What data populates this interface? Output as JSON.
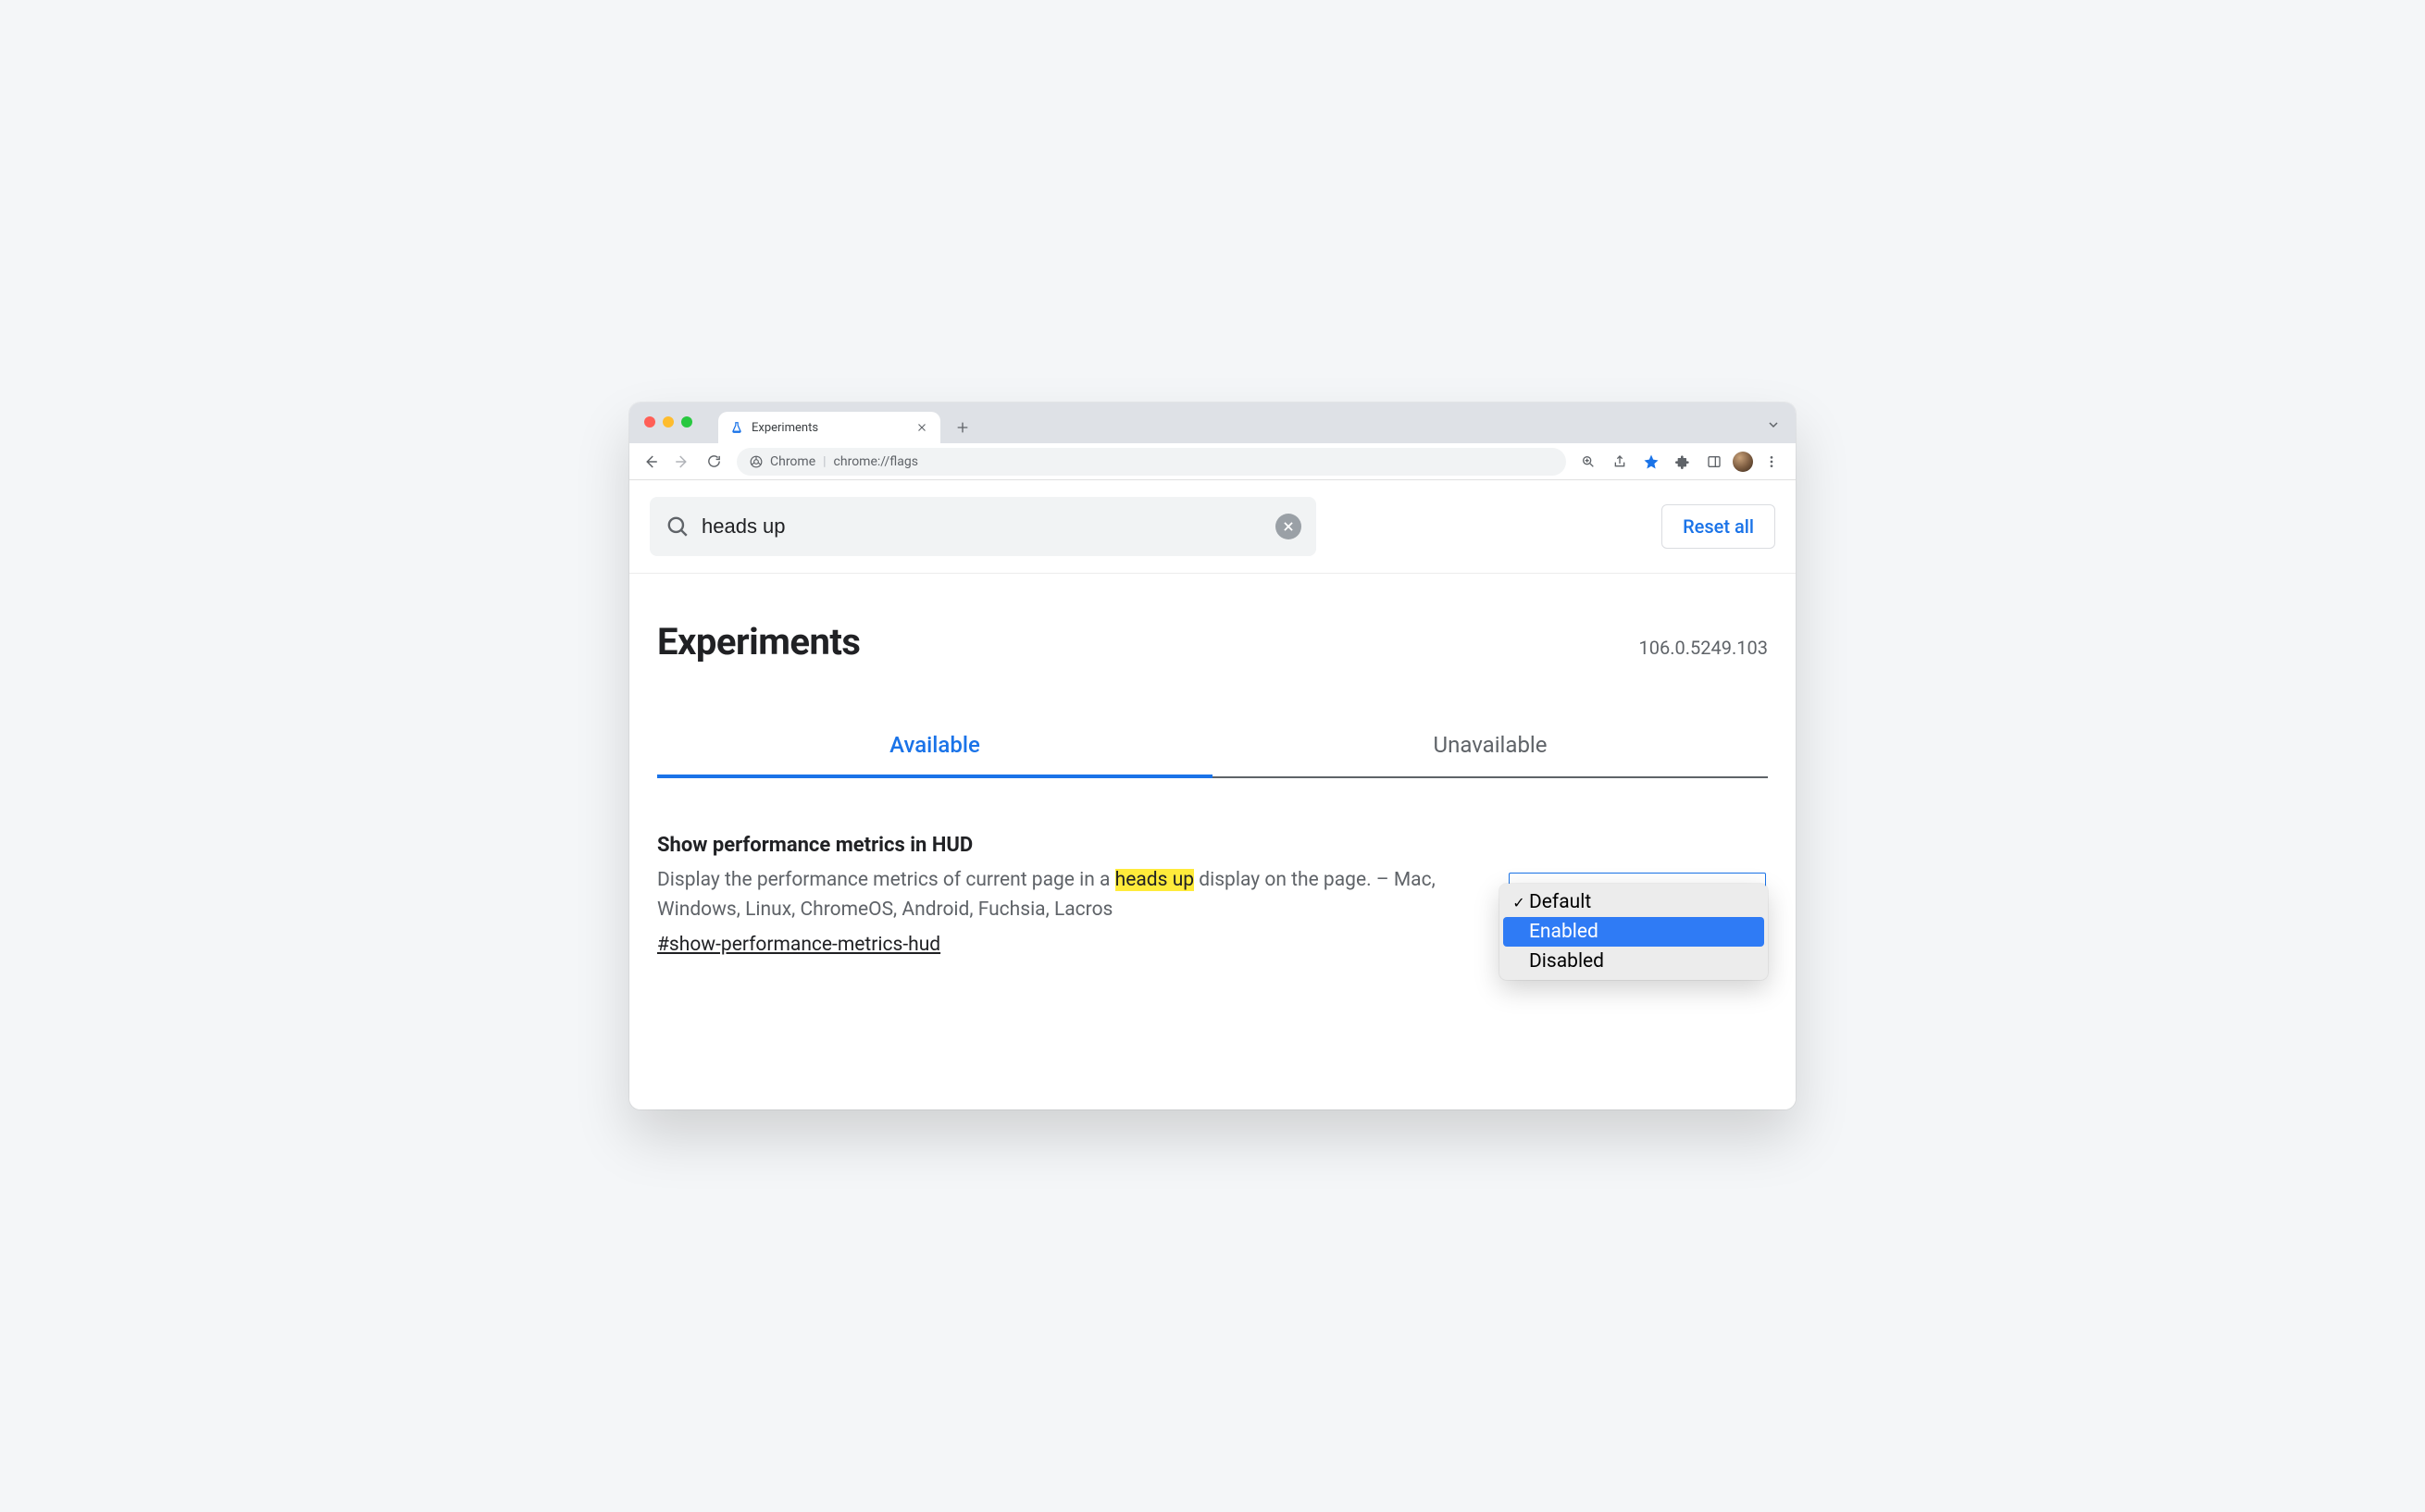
{
  "browser": {
    "tab_title": "Experiments",
    "omnibox": {
      "origin": "Chrome",
      "url": "chrome://flags"
    }
  },
  "search": {
    "value": "heads up",
    "reset_label": "Reset all"
  },
  "header": {
    "title": "Experiments",
    "version": "106.0.5249.103"
  },
  "tabs": {
    "available": "Available",
    "unavailable": "Unavailable"
  },
  "flag": {
    "title": "Show performance metrics in HUD",
    "desc_pre": "Display the performance metrics of current page in a ",
    "desc_highlight": "heads up",
    "desc_post": " display on the page. – Mac, Windows, Linux, ChromeOS, Android, Fuchsia, Lacros",
    "anchor": "#show-performance-metrics-hud",
    "options": {
      "default": "Default",
      "enabled": "Enabled",
      "disabled": "Disabled"
    }
  }
}
